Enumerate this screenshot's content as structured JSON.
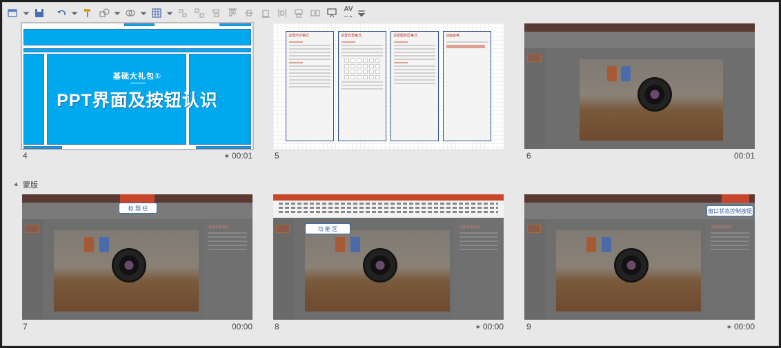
{
  "toolbar": {
    "icons": [
      "new-slide-icon",
      "save-icon",
      "undo-icon",
      "format-painter-icon",
      "shapes-icon",
      "group-icon",
      "grid-icon",
      "align-icon",
      "distribute-icon",
      "char-spacing-icon"
    ],
    "char_spacing_label": "AV"
  },
  "section": {
    "name": "蒙版"
  },
  "slides": [
    {
      "number": "4",
      "time": "00:01",
      "starred": true,
      "subtitle": "基础大礼包①",
      "title": "PPT界面及按钮认识"
    },
    {
      "number": "5",
      "time": "",
      "starred": false,
      "panes": [
        "设置形状格式",
        "设置背景格式",
        "设置图表区格式",
        "动画窗格"
      ]
    },
    {
      "number": "6",
      "time": "00:01",
      "starred": false
    },
    {
      "number": "7",
      "time": "00:00",
      "starred": false,
      "tag": "标 题 栏"
    },
    {
      "number": "8",
      "time": "00:00",
      "starred": true,
      "tag": "功 能 区"
    },
    {
      "number": "9",
      "time": "00:00",
      "starred": true,
      "tag": "窗口状态控制按钮"
    }
  ],
  "colors": {
    "accent_blue": "#00a8ee",
    "tag_border": "#3c6eb4",
    "title_bar": "#c8472a"
  }
}
